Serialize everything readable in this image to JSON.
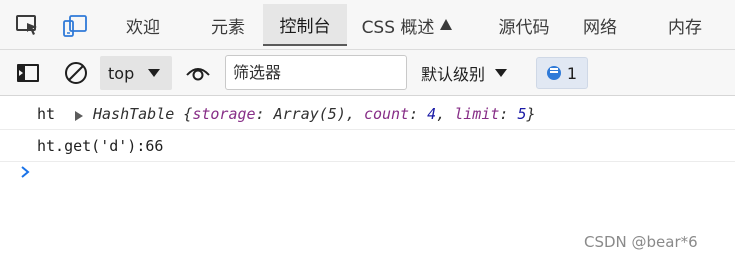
{
  "tabs": [
    {
      "label": "欢迎"
    },
    {
      "label": "元素"
    },
    {
      "label": "控制台"
    },
    {
      "label": "CSS 概述"
    },
    {
      "label": "源代码"
    },
    {
      "label": "网络"
    },
    {
      "label": "内存"
    }
  ],
  "active_tab": "控制台",
  "toolbar": {
    "context": "top",
    "filter_placeholder": "筛选器",
    "level": "默认级别",
    "message_count": "1"
  },
  "console": {
    "line1": {
      "label": "ht",
      "class_name": "HashTable",
      "storage_key": "storage",
      "storage_value": "Array(5)",
      "count_key": "count",
      "count_value": "4",
      "limit_key": "limit",
      "limit_value": "5"
    },
    "line2": "ht.get('d'):66"
  },
  "watermark": "CSDN @bear*6",
  "icons": [
    "inspect-element-icon",
    "device-emulation-icon",
    "flask-icon",
    "sidebar-toggle-icon",
    "clear-console-icon",
    "live-expression-eye-icon",
    "dropdown-caret-icon",
    "message-icon",
    "expand-triangle-icon",
    "prompt-chevron-icon"
  ],
  "colors": {
    "accent": "#2f7ad8",
    "key": "#872e87",
    "number": "#1a1aa6"
  }
}
